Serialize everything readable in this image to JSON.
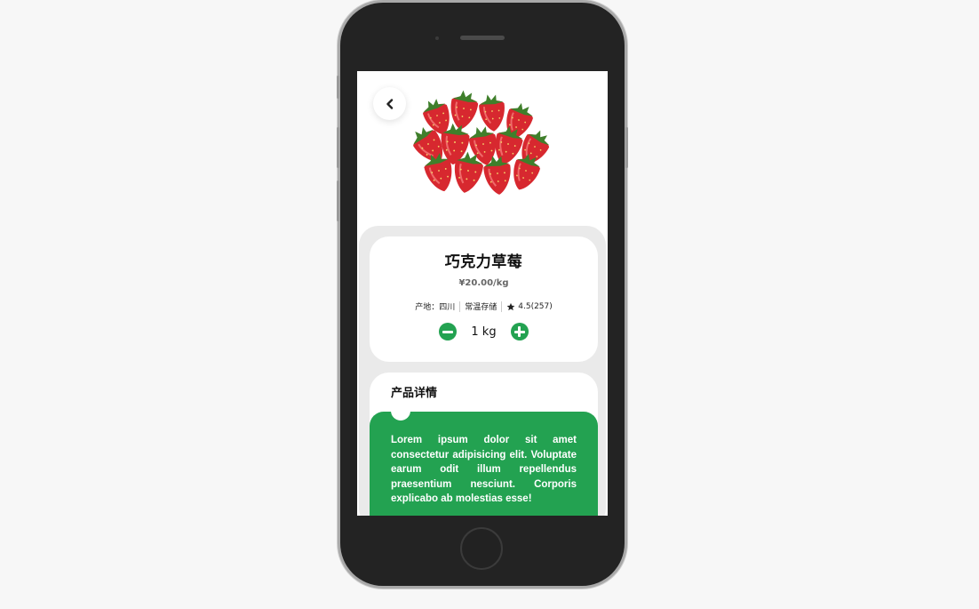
{
  "product": {
    "name": "巧克力草莓",
    "price": "¥20.00/kg",
    "origin": "产地：四川",
    "storage": "常温存储",
    "rating": "4.5(257)"
  },
  "quantity": {
    "value": "1 kg"
  },
  "details": {
    "heading": "产品详情",
    "description": "Lorem ipsum dolor sit amet consectetur adipisicing elit. Voluptate earum odit illum repellendus praesentium nesciunt. Corporis explicabo ab molestias esse!"
  },
  "colors": {
    "accent": "#23a251",
    "panel": "#eaeaea",
    "phone": "#232323"
  },
  "icons": {
    "back": "chevron-left-icon",
    "minus": "minus-icon",
    "plus": "plus-icon",
    "star": "star-icon"
  }
}
